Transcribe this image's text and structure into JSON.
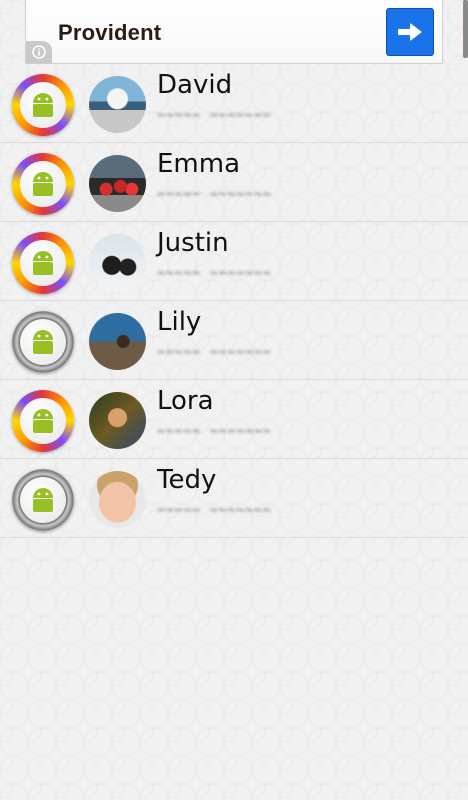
{
  "ad": {
    "title": "Provident",
    "info_icon": "info-icon",
    "arrow_icon": "arrow-right-icon",
    "button_color": "#1a73e8"
  },
  "contacts": [
    {
      "name": "David",
      "status": "~~~~~ ~~~~~~~",
      "ring": "color"
    },
    {
      "name": "Emma",
      "status": "~~~~~ ~~~~~~~",
      "ring": "color"
    },
    {
      "name": "Justin",
      "status": "~~~~~ ~~~~~~~",
      "ring": "color"
    },
    {
      "name": "Lily",
      "status": "~~~~~ ~~~~~~~",
      "ring": "gray"
    },
    {
      "name": "Lora",
      "status": "~~~~~ ~~~~~~~",
      "ring": "color"
    },
    {
      "name": "Tedy",
      "status": "~~~~~ ~~~~~~~",
      "ring": "gray"
    }
  ],
  "icons": {
    "status": "android-icon"
  }
}
